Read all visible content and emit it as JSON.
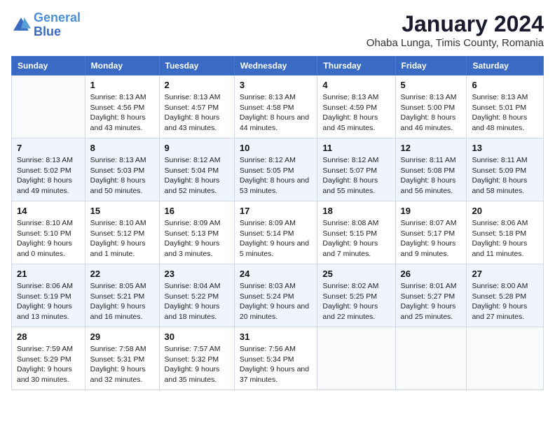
{
  "header": {
    "logo_line1": "General",
    "logo_line2": "Blue",
    "title": "January 2024",
    "subtitle": "Ohaba Lunga, Timis County, Romania"
  },
  "weekdays": [
    "Sunday",
    "Monday",
    "Tuesday",
    "Wednesday",
    "Thursday",
    "Friday",
    "Saturday"
  ],
  "weeks": [
    [
      {
        "day": "",
        "sunrise": "",
        "sunset": "",
        "daylight": ""
      },
      {
        "day": "1",
        "sunrise": "Sunrise: 8:13 AM",
        "sunset": "Sunset: 4:56 PM",
        "daylight": "Daylight: 8 hours and 43 minutes."
      },
      {
        "day": "2",
        "sunrise": "Sunrise: 8:13 AM",
        "sunset": "Sunset: 4:57 PM",
        "daylight": "Daylight: 8 hours and 43 minutes."
      },
      {
        "day": "3",
        "sunrise": "Sunrise: 8:13 AM",
        "sunset": "Sunset: 4:58 PM",
        "daylight": "Daylight: 8 hours and 44 minutes."
      },
      {
        "day": "4",
        "sunrise": "Sunrise: 8:13 AM",
        "sunset": "Sunset: 4:59 PM",
        "daylight": "Daylight: 8 hours and 45 minutes."
      },
      {
        "day": "5",
        "sunrise": "Sunrise: 8:13 AM",
        "sunset": "Sunset: 5:00 PM",
        "daylight": "Daylight: 8 hours and 46 minutes."
      },
      {
        "day": "6",
        "sunrise": "Sunrise: 8:13 AM",
        "sunset": "Sunset: 5:01 PM",
        "daylight": "Daylight: 8 hours and 48 minutes."
      }
    ],
    [
      {
        "day": "7",
        "sunrise": "Sunrise: 8:13 AM",
        "sunset": "Sunset: 5:02 PM",
        "daylight": "Daylight: 8 hours and 49 minutes."
      },
      {
        "day": "8",
        "sunrise": "Sunrise: 8:13 AM",
        "sunset": "Sunset: 5:03 PM",
        "daylight": "Daylight: 8 hours and 50 minutes."
      },
      {
        "day": "9",
        "sunrise": "Sunrise: 8:12 AM",
        "sunset": "Sunset: 5:04 PM",
        "daylight": "Daylight: 8 hours and 52 minutes."
      },
      {
        "day": "10",
        "sunrise": "Sunrise: 8:12 AM",
        "sunset": "Sunset: 5:05 PM",
        "daylight": "Daylight: 8 hours and 53 minutes."
      },
      {
        "day": "11",
        "sunrise": "Sunrise: 8:12 AM",
        "sunset": "Sunset: 5:07 PM",
        "daylight": "Daylight: 8 hours and 55 minutes."
      },
      {
        "day": "12",
        "sunrise": "Sunrise: 8:11 AM",
        "sunset": "Sunset: 5:08 PM",
        "daylight": "Daylight: 8 hours and 56 minutes."
      },
      {
        "day": "13",
        "sunrise": "Sunrise: 8:11 AM",
        "sunset": "Sunset: 5:09 PM",
        "daylight": "Daylight: 8 hours and 58 minutes."
      }
    ],
    [
      {
        "day": "14",
        "sunrise": "Sunrise: 8:10 AM",
        "sunset": "Sunset: 5:10 PM",
        "daylight": "Daylight: 9 hours and 0 minutes."
      },
      {
        "day": "15",
        "sunrise": "Sunrise: 8:10 AM",
        "sunset": "Sunset: 5:12 PM",
        "daylight": "Daylight: 9 hours and 1 minute."
      },
      {
        "day": "16",
        "sunrise": "Sunrise: 8:09 AM",
        "sunset": "Sunset: 5:13 PM",
        "daylight": "Daylight: 9 hours and 3 minutes."
      },
      {
        "day": "17",
        "sunrise": "Sunrise: 8:09 AM",
        "sunset": "Sunset: 5:14 PM",
        "daylight": "Daylight: 9 hours and 5 minutes."
      },
      {
        "day": "18",
        "sunrise": "Sunrise: 8:08 AM",
        "sunset": "Sunset: 5:15 PM",
        "daylight": "Daylight: 9 hours and 7 minutes."
      },
      {
        "day": "19",
        "sunrise": "Sunrise: 8:07 AM",
        "sunset": "Sunset: 5:17 PM",
        "daylight": "Daylight: 9 hours and 9 minutes."
      },
      {
        "day": "20",
        "sunrise": "Sunrise: 8:06 AM",
        "sunset": "Sunset: 5:18 PM",
        "daylight": "Daylight: 9 hours and 11 minutes."
      }
    ],
    [
      {
        "day": "21",
        "sunrise": "Sunrise: 8:06 AM",
        "sunset": "Sunset: 5:19 PM",
        "daylight": "Daylight: 9 hours and 13 minutes."
      },
      {
        "day": "22",
        "sunrise": "Sunrise: 8:05 AM",
        "sunset": "Sunset: 5:21 PM",
        "daylight": "Daylight: 9 hours and 16 minutes."
      },
      {
        "day": "23",
        "sunrise": "Sunrise: 8:04 AM",
        "sunset": "Sunset: 5:22 PM",
        "daylight": "Daylight: 9 hours and 18 minutes."
      },
      {
        "day": "24",
        "sunrise": "Sunrise: 8:03 AM",
        "sunset": "Sunset: 5:24 PM",
        "daylight": "Daylight: 9 hours and 20 minutes."
      },
      {
        "day": "25",
        "sunrise": "Sunrise: 8:02 AM",
        "sunset": "Sunset: 5:25 PM",
        "daylight": "Daylight: 9 hours and 22 minutes."
      },
      {
        "day": "26",
        "sunrise": "Sunrise: 8:01 AM",
        "sunset": "Sunset: 5:27 PM",
        "daylight": "Daylight: 9 hours and 25 minutes."
      },
      {
        "day": "27",
        "sunrise": "Sunrise: 8:00 AM",
        "sunset": "Sunset: 5:28 PM",
        "daylight": "Daylight: 9 hours and 27 minutes."
      }
    ],
    [
      {
        "day": "28",
        "sunrise": "Sunrise: 7:59 AM",
        "sunset": "Sunset: 5:29 PM",
        "daylight": "Daylight: 9 hours and 30 minutes."
      },
      {
        "day": "29",
        "sunrise": "Sunrise: 7:58 AM",
        "sunset": "Sunset: 5:31 PM",
        "daylight": "Daylight: 9 hours and 32 minutes."
      },
      {
        "day": "30",
        "sunrise": "Sunrise: 7:57 AM",
        "sunset": "Sunset: 5:32 PM",
        "daylight": "Daylight: 9 hours and 35 minutes."
      },
      {
        "day": "31",
        "sunrise": "Sunrise: 7:56 AM",
        "sunset": "Sunset: 5:34 PM",
        "daylight": "Daylight: 9 hours and 37 minutes."
      },
      {
        "day": "",
        "sunrise": "",
        "sunset": "",
        "daylight": ""
      },
      {
        "day": "",
        "sunrise": "",
        "sunset": "",
        "daylight": ""
      },
      {
        "day": "",
        "sunrise": "",
        "sunset": "",
        "daylight": ""
      }
    ]
  ]
}
